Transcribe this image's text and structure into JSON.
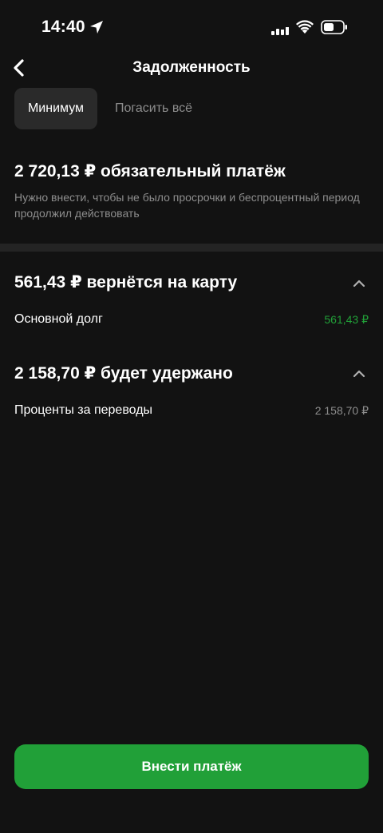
{
  "status_bar": {
    "time": "14:40"
  },
  "header": {
    "title": "Задолженность"
  },
  "tabs": [
    {
      "label": "Минимум",
      "active": true
    },
    {
      "label": "Погасить всё",
      "active": false
    }
  ],
  "payment": {
    "title": "2 720,13 ₽ обязательный платёж",
    "description": "Нужно внести, чтобы не было просрочки и беспроцентный период продолжил действовать"
  },
  "sections": [
    {
      "title": "561,43 ₽ вернётся на карту",
      "row_label": "Основной долг",
      "row_value": "561,43 ₽",
      "value_color": "#21a038"
    },
    {
      "title": "2 158,70 ₽ будет удержано",
      "row_label": "Проценты за переводы",
      "row_value": "2 158,70 ₽",
      "value_color": "#8d8d8d"
    }
  ],
  "cta": {
    "label": "Внести платёж",
    "color": "#21a038"
  },
  "icons": {
    "back": "chevron-left-icon",
    "collapse": "chevron-up-icon",
    "location": "location-arrow-icon",
    "signal": "cellular-signal-icon",
    "wifi": "wifi-icon",
    "battery": "battery-icon"
  }
}
